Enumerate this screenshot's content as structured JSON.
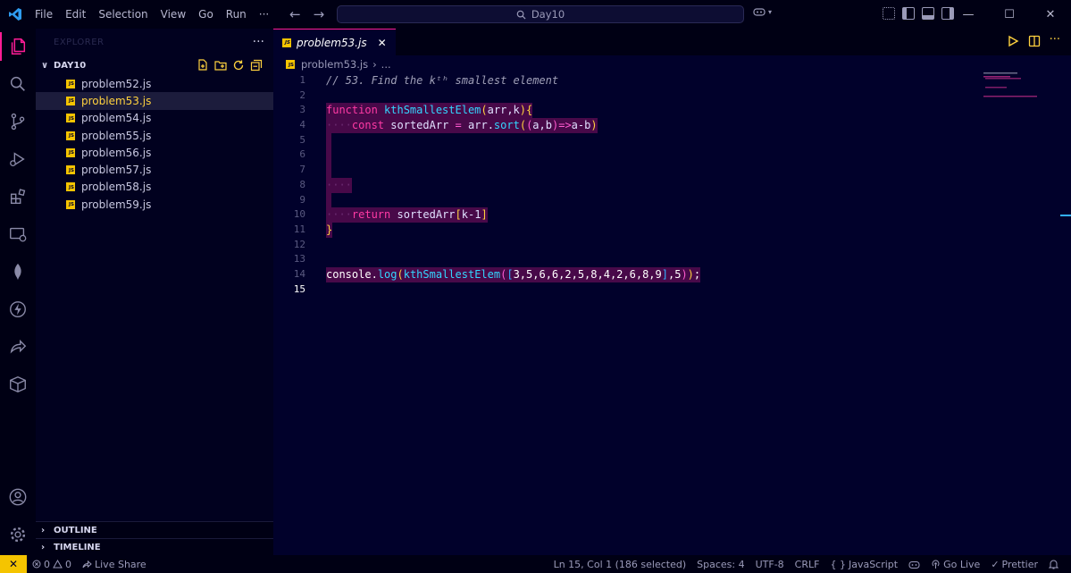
{
  "titlebar": {
    "menu": [
      "File",
      "Edit",
      "Selection",
      "View",
      "Go",
      "Run",
      "···"
    ],
    "search": "Day10"
  },
  "sidebar": {
    "title": "EXPLORER",
    "more": "···",
    "folder": "DAY10",
    "files": [
      "problem52.js",
      "problem53.js",
      "problem54.js",
      "problem55.js",
      "problem56.js",
      "problem57.js",
      "problem58.js",
      "problem59.js"
    ],
    "active_file_index": 1,
    "outline": "OUTLINE",
    "timeline": "TIMELINE"
  },
  "editor": {
    "tab": "problem53.js",
    "badge": "JS",
    "breadcrumb_file": "problem53.js",
    "breadcrumb_sep": "›",
    "breadcrumb_more": "...",
    "line_numbers": [
      "1",
      "2",
      "3",
      "4",
      "5",
      "6",
      "7",
      "8",
      "9",
      "10",
      "11",
      "12",
      "13",
      "14",
      "15"
    ],
    "code": {
      "l1": "// 53. Find the kᵗʰ smallest element",
      "l3_kw": "function",
      "l3_fn": "kthSmallestElem",
      "l3_p1": "(",
      "l3_args": "arr,k",
      "l3_p2": "){",
      "l4_ws": "····",
      "l4_kw": "const",
      "l4_var": "sortedArr",
      "l4_eq": "=",
      "l4_obj": "arr",
      "l4_dot": ".",
      "l4_m": "sort",
      "l4_o1": "(",
      "l4_o2": "(",
      "l4_ab": "a,b",
      "l4_c2": ")",
      "l4_arrow": "=>",
      "l4_expr": "a-b",
      "l4_c1": ")",
      "l8_ws": "····",
      "l10_ws": "····",
      "l10_kw": "return",
      "l10_var": "sortedArr",
      "l10_b1": "[",
      "l10_idx": "k-1",
      "l10_b2": "]",
      "l11": "}",
      "l14_obj": "console",
      "l14_dot": ".",
      "l14_m": "log",
      "l14_o1": "(",
      "l14_fn": "kthSmallestElem",
      "l14_o2": "(",
      "l14_b1": "[",
      "l14_arr": "3,5,6,6,2,5,8,4,2,6,8,9",
      "l14_b2": "]",
      "l14_rest": ",5",
      "l14_c2": ")",
      "l14_c1": ")",
      "l14_semi": ";"
    }
  },
  "statusbar": {
    "errors": "0",
    "warnings": "0",
    "live_share": "Live Share",
    "position": "Ln 15, Col 1 (186 selected)",
    "spaces": "Spaces: 4",
    "encoding": "UTF-8",
    "eol": "CRLF",
    "language_icon": "{ }",
    "language": "JavaScript",
    "go_live": "Go Live",
    "prettier": "Prettier"
  },
  "colors": {
    "background": "#01012b",
    "accent_pink": "#ff1c96",
    "accent_yellow": "#f5c400",
    "function_cyan": "#33d6ff"
  }
}
